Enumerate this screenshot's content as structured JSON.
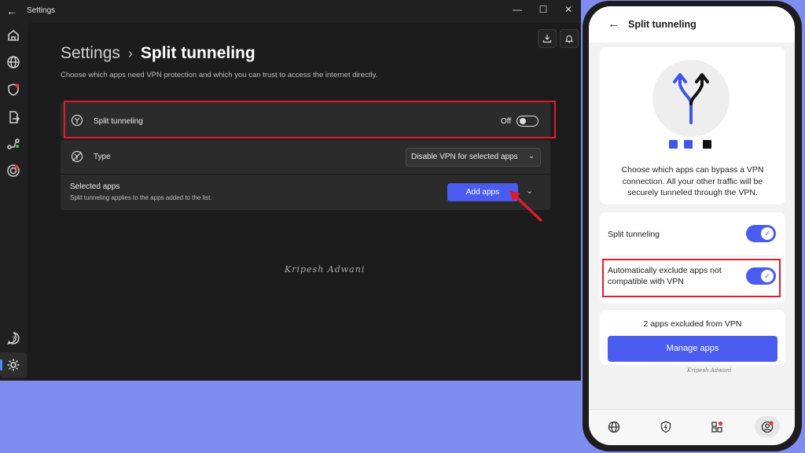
{
  "window": {
    "title": "Settings",
    "breadcrumb_parent": "Settings",
    "breadcrumb_current": "Split tunneling",
    "subtitle": "Choose which apps need VPN protection and which you can trust to access the internet directly.",
    "split_tunneling_label": "Split tunneling",
    "split_tunneling_state": "Off",
    "type_label": "Type",
    "type_value": "Disable VPN for selected apps",
    "selected_apps_title": "Selected apps",
    "selected_apps_sub": "Split tunneling applies to the apps added to the list.",
    "add_apps_label": "Add apps",
    "signature": "Kripesh Adwani"
  },
  "phone": {
    "title": "Split tunneling",
    "description": "Choose which apps can bypass a VPN connection. All your other traffic will be securely tunneled through the VPN.",
    "split_tunneling_label": "Split tunneling",
    "auto_exclude_label": "Automatically exclude apps not compatible with VPN",
    "excluded_count_text": "2 apps excluded from VPN",
    "manage_apps_label": "Manage apps",
    "signature": "Kripesh Adwani",
    "split_tunneling_on": true,
    "auto_exclude_on": true
  },
  "colors": {
    "accent": "#4a5cf0",
    "highlight": "#e01a2a",
    "background": "#7f8df0",
    "dark_bg": "#1c1c1c",
    "dot_blue": "#3f57e8",
    "dot_black": "#111111"
  },
  "icons": {
    "rail": [
      "home-icon",
      "globe-icon",
      "shield-icon",
      "export-icon",
      "route-icon",
      "target-icon",
      "help-icon",
      "gear-icon"
    ],
    "phone_nav": [
      "globe-icon",
      "shield-bolt-icon",
      "apps-icon",
      "profile-icon"
    ]
  }
}
